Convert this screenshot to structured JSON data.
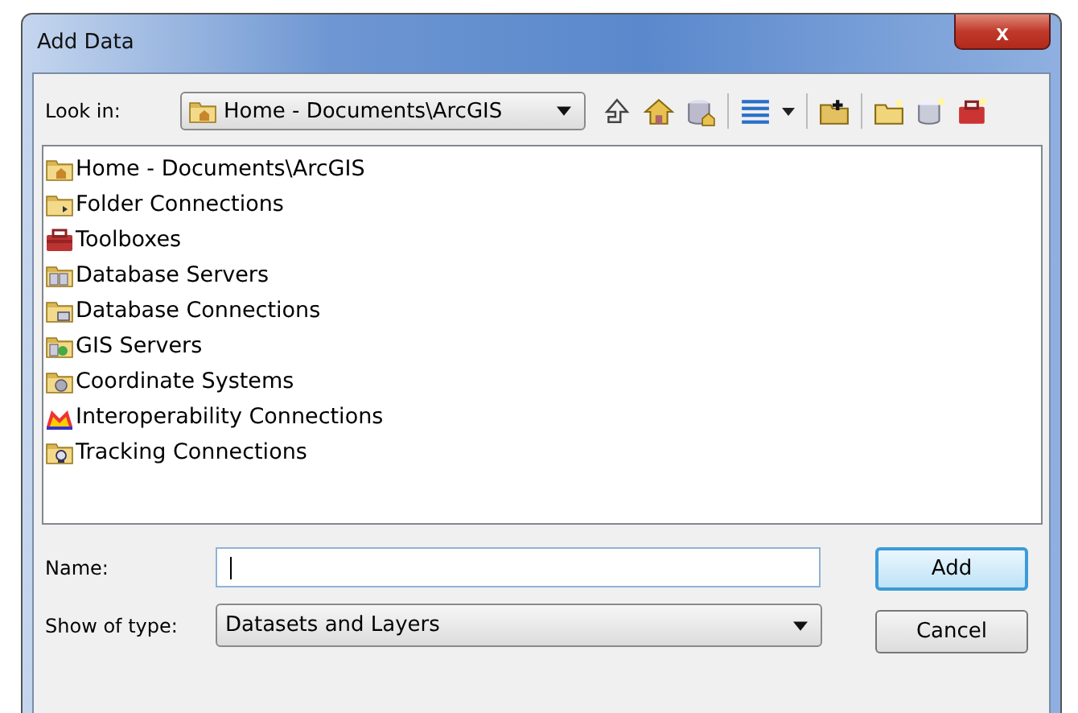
{
  "window": {
    "title": "Add Data",
    "close": "x"
  },
  "look_in": {
    "label": "Look in:",
    "value": "Home - Documents\\ArcGIS"
  },
  "items": [
    {
      "label": "Home - Documents\\ArcGIS",
      "kind": "home"
    },
    {
      "label": "Folder Connections",
      "kind": "folder"
    },
    {
      "label": "Toolboxes",
      "kind": "toolbox"
    },
    {
      "label": "Database Servers",
      "kind": "server"
    },
    {
      "label": "Database Connections",
      "kind": "dbconn"
    },
    {
      "label": "GIS Servers",
      "kind": "gis"
    },
    {
      "label": "Coordinate Systems",
      "kind": "globe"
    },
    {
      "label": "Interoperability Connections",
      "kind": "interop"
    },
    {
      "label": "Tracking Connections",
      "kind": "tracking"
    }
  ],
  "name_field": {
    "label": "Name:"
  },
  "type_field": {
    "label": "Show of type:",
    "value": "Datasets and Layers"
  },
  "buttons": [
    {
      "label": "Add",
      "default": true
    },
    {
      "label": "Cancel",
      "default": false
    }
  ]
}
